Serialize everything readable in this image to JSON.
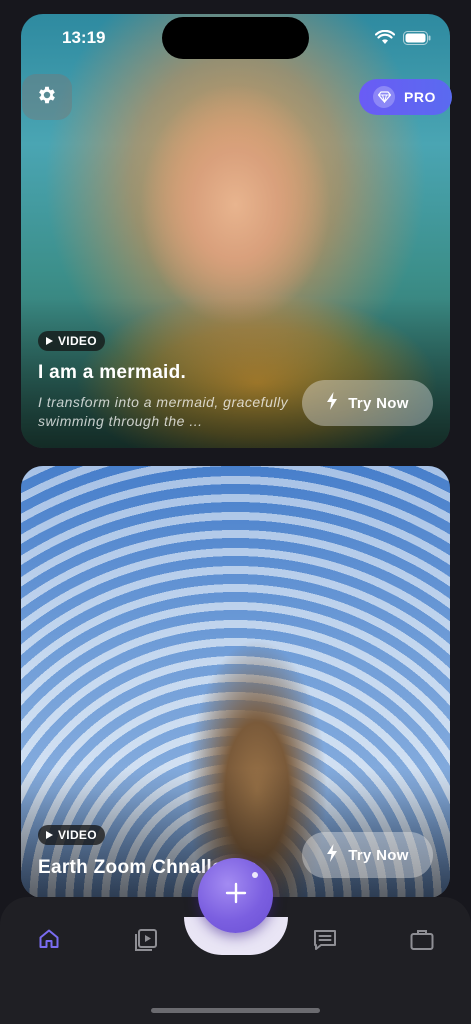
{
  "status_bar": {
    "time": "13:19"
  },
  "header": {
    "pro_label": "PRO"
  },
  "cards": [
    {
      "badge": "VIDEO",
      "title": "I am a mermaid.",
      "description": "I transform into a mermaid, gracefully swimming through the ...",
      "cta": "Try Now"
    },
    {
      "badge": "VIDEO",
      "title": "Earth Zoom Chnallenge",
      "cta": "Try Now"
    }
  ],
  "tab_bar": {
    "items": [
      {
        "icon": "home-icon",
        "active": true
      },
      {
        "icon": "video-library-icon",
        "active": false
      },
      {
        "icon": "create-plus-icon",
        "active": false
      },
      {
        "icon": "chat-icon",
        "active": false
      },
      {
        "icon": "briefcase-icon",
        "active": false
      }
    ],
    "active_color": "#7a6cf0",
    "inactive_color": "#8e8e94"
  },
  "colors": {
    "pro_gradient_start": "#6a5cf5",
    "fab": "#7b5fe0",
    "background": "#17171d"
  }
}
